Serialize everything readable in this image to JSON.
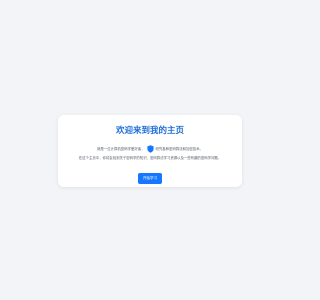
{
  "colors": {
    "background": "#f2f4f7",
    "card": "#ffffff",
    "title": "#1f6fd6",
    "text": "#555b66",
    "accent": "#1677ff",
    "button_text": "#ffffff"
  },
  "card": {
    "title": "欢迎来到我的主页",
    "intro_before_icon": "我是一位计算机密码学爱好者，",
    "intro_after_icon": "研究各种密码算法和加密技术。",
    "icon": "shield-icon",
    "description": "在这个主页中，你将会找到关于密码学的知识、密码算法学习资源以及一些有趣的密码学问题。",
    "button_label": "开始学习"
  }
}
